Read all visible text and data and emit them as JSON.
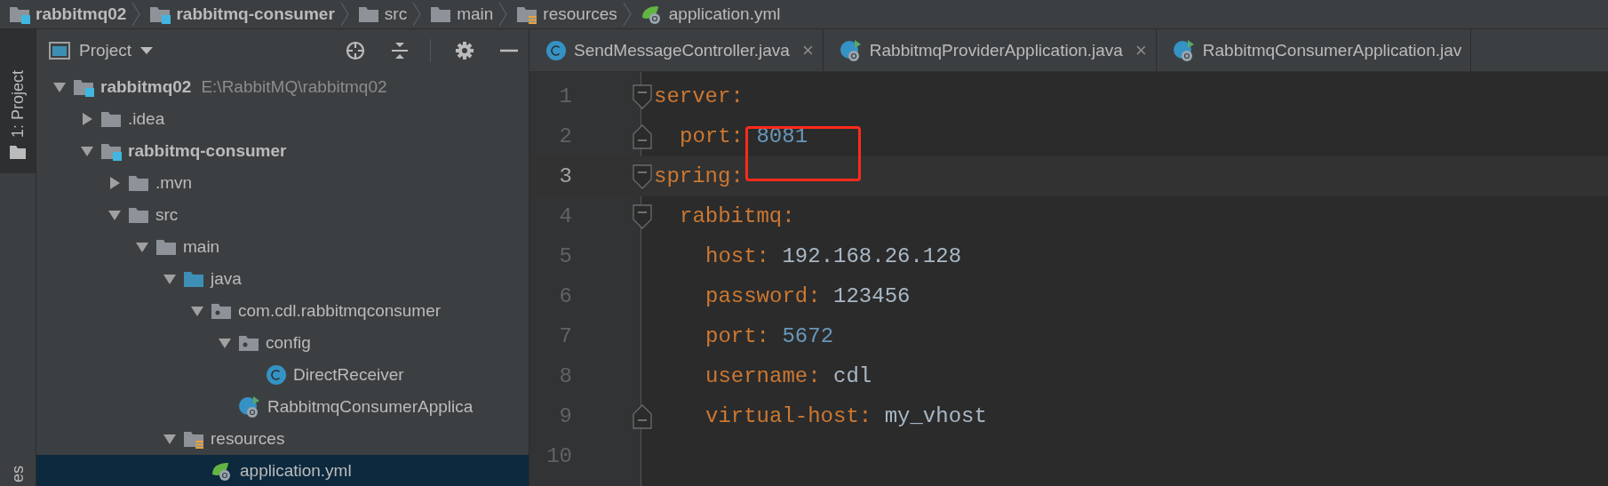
{
  "breadcrumb": [
    {
      "label": "rabbitmq02",
      "kind": "module"
    },
    {
      "label": "rabbitmq-consumer",
      "kind": "module"
    },
    {
      "label": "src",
      "kind": "folder"
    },
    {
      "label": "main",
      "kind": "folder"
    },
    {
      "label": "resources",
      "kind": "resources"
    },
    {
      "label": "application.yml",
      "kind": "yml"
    }
  ],
  "tool_strip": {
    "tab": "1: Project",
    "bottom_tab": "es"
  },
  "project_panel": {
    "title": "Project",
    "tree": [
      {
        "label": "rabbitmq02",
        "path": "E:\\RabbitMQ\\rabbitmq02",
        "kind": "module",
        "expanded": true,
        "selected": false,
        "children": [
          {
            "label": ".idea",
            "kind": "folder",
            "expanded": false,
            "selected": false
          },
          {
            "label": "rabbitmq-consumer",
            "kind": "module",
            "expanded": true,
            "selected": false,
            "children": [
              {
                "label": ".mvn",
                "kind": "folder",
                "expanded": false,
                "selected": false
              },
              {
                "label": "src",
                "kind": "folder",
                "expanded": true,
                "selected": false,
                "children": [
                  {
                    "label": "main",
                    "kind": "folder",
                    "expanded": true,
                    "selected": false,
                    "children": [
                      {
                        "label": "java",
                        "kind": "source_folder",
                        "expanded": true,
                        "selected": false,
                        "children": [
                          {
                            "label": "com.cdl.rabbitmqconsumer",
                            "kind": "package",
                            "expanded": true,
                            "selected": false,
                            "children": [
                              {
                                "label": "config",
                                "kind": "package",
                                "expanded": true,
                                "selected": false,
                                "children": [
                                  {
                                    "label": "DirectReceiver",
                                    "kind": "class",
                                    "selected": false
                                  }
                                ]
                              },
                              {
                                "label": "RabbitmqConsumerApplica",
                                "kind": "spring_class",
                                "selected": false
                              }
                            ]
                          }
                        ]
                      },
                      {
                        "label": "resources",
                        "kind": "resources",
                        "expanded": true,
                        "selected": false,
                        "children": [
                          {
                            "label": "application.yml",
                            "kind": "yml",
                            "selected": true
                          }
                        ]
                      }
                    ]
                  }
                ]
              }
            ]
          }
        ]
      }
    ]
  },
  "editor_tabs": [
    {
      "label": "SendMessageController.java",
      "kind": "class",
      "close": "×"
    },
    {
      "label": "RabbitmqProviderApplication.java",
      "kind": "spring_class",
      "close": "×"
    },
    {
      "label": "RabbitmqConsumerApplication.jav",
      "kind": "spring_class"
    }
  ],
  "code": [
    {
      "number": "1",
      "key": "server:",
      "fold_start": true,
      "fold_end": false,
      "current": false,
      "boxed": false,
      "children": [
        {
          "number": "2",
          "key": "port:",
          "value": "8081",
          "numeric": true,
          "fold_start": false,
          "fold_end": true,
          "current": false,
          "boxed": true
        }
      ]
    },
    {
      "number": "3",
      "key": "spring:",
      "fold_start": true,
      "fold_end": false,
      "current": true,
      "boxed": false,
      "children": [
        {
          "number": "4",
          "key": "rabbitmq:",
          "fold_start": true,
          "fold_end": false,
          "current": false,
          "boxed": false,
          "children": [
            {
              "number": "5",
              "key": "host:",
              "value": "192.168.26.128",
              "numeric": false,
              "fold_start": false,
              "fold_end": false,
              "current": false,
              "boxed": false
            },
            {
              "number": "6",
              "key": "password:",
              "value": "123456",
              "numeric": false,
              "fold_start": false,
              "fold_end": false,
              "current": false,
              "boxed": false
            },
            {
              "number": "7",
              "key": "port:",
              "value": "5672",
              "numeric": true,
              "fold_start": false,
              "fold_end": false,
              "current": false,
              "boxed": false
            },
            {
              "number": "8",
              "key": "username:",
              "value": "cdl",
              "numeric": false,
              "fold_start": false,
              "fold_end": false,
              "current": false,
              "boxed": false
            },
            {
              "number": "9",
              "key": "virtual-host:",
              "value": "my_vhost",
              "numeric": false,
              "fold_start": false,
              "fold_end": true,
              "current": false,
              "boxed": false
            }
          ]
        }
      ]
    },
    {
      "number": "10",
      "fold_start": false,
      "fold_end": false,
      "current": false,
      "boxed": false
    }
  ]
}
